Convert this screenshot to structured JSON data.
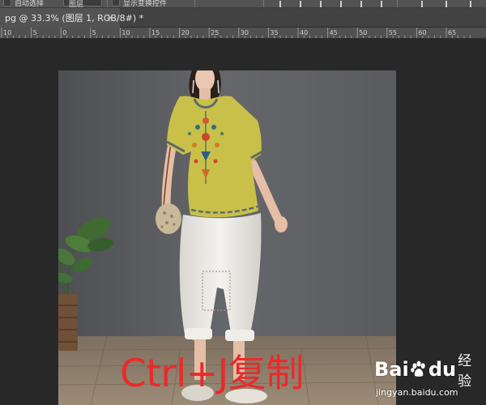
{
  "options_bar": {
    "auto_select_label": "自动选择",
    "layer_dropdown_value": "图层",
    "show_transform_label": "显示变换控件"
  },
  "document_tab": {
    "title": "pg @ 33.3% (图层 1, RGB/8#) *",
    "close_glyph": "×"
  },
  "ruler": {
    "labels": [
      "10",
      "5",
      "0",
      "5",
      "10",
      "15",
      "20",
      "25",
      "30",
      "35",
      "40",
      "45",
      "50",
      "55",
      "60",
      "65"
    ]
  },
  "caption": {
    "text": "Ctrl+J复制"
  },
  "watermark": {
    "brand_left": "Bai",
    "brand_right": "du",
    "brand_cn": "经验",
    "url": "jingyan.baidu.com"
  },
  "colors": {
    "workspace": "#282828",
    "panel": "#535353",
    "caption_red": "#ea2a2a",
    "blouse_yellow": "#c9c04a",
    "backdrop_gray": "#5c5d60",
    "floor": "#8a7a68"
  }
}
